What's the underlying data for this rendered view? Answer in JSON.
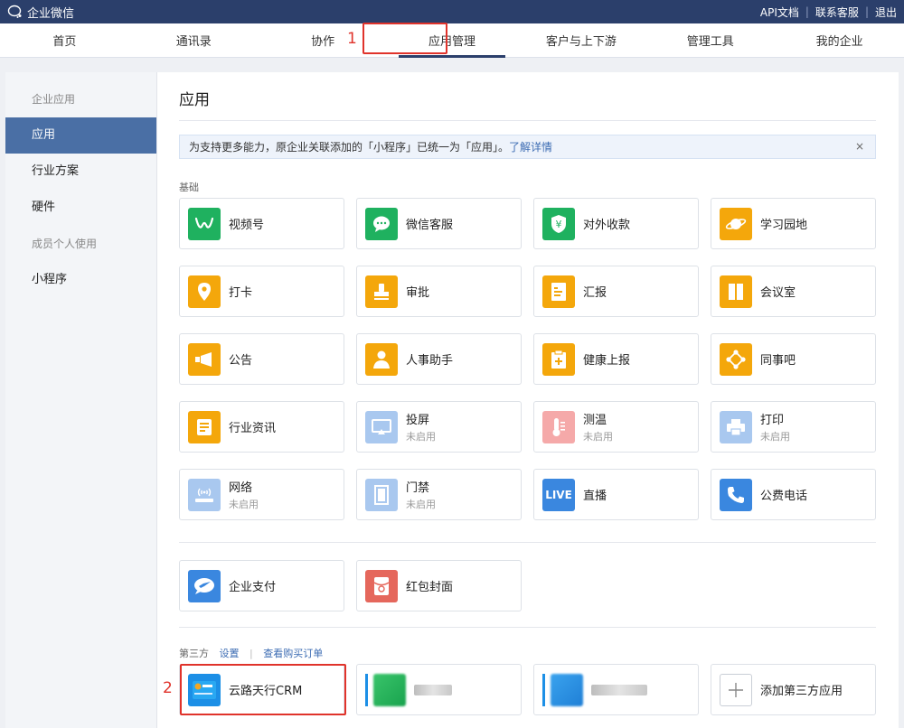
{
  "topbar": {
    "brand": "企业微信",
    "links": [
      "API文档",
      "联系客服",
      "退出"
    ]
  },
  "nav": {
    "tabs": [
      "首页",
      "通讯录",
      "协作",
      "应用管理",
      "客户与上下游",
      "管理工具",
      "我的企业"
    ],
    "active": "应用管理"
  },
  "annotations": {
    "a1": "1",
    "a2": "2"
  },
  "sidebar": {
    "group1": "企业应用",
    "items": [
      "应用",
      "行业方案",
      "硬件"
    ],
    "group2": "成员个人使用",
    "items2": [
      "小程序"
    ]
  },
  "main": {
    "title": "应用",
    "notice": {
      "text": "为支持更多能力，原企业关联添加的「小程序」已统一为「应用」。",
      "link": "了解详情",
      "close": "×"
    },
    "basic_label": "基础",
    "apps": [
      {
        "name": "视频号",
        "icon": "video-channel-icon",
        "color": "#1fb15f"
      },
      {
        "name": "微信客服",
        "icon": "wechat-service-icon",
        "color": "#1fb15f"
      },
      {
        "name": "对外收款",
        "icon": "yen-shield-icon",
        "color": "#1fb15f"
      },
      {
        "name": "学习园地",
        "icon": "planet-icon",
        "color": "#f4a70b"
      },
      {
        "name": "打卡",
        "icon": "location-pin-icon",
        "color": "#f4a70b"
      },
      {
        "name": "审批",
        "icon": "stamp-icon",
        "color": "#f4a70b"
      },
      {
        "name": "汇报",
        "icon": "report-icon",
        "color": "#f4a70b"
      },
      {
        "name": "会议室",
        "icon": "door-icon",
        "color": "#f4a70b"
      },
      {
        "name": "公告",
        "icon": "megaphone-icon",
        "color": "#f4a70b"
      },
      {
        "name": "人事助手",
        "icon": "person-icon",
        "color": "#f4a70b"
      },
      {
        "name": "健康上报",
        "icon": "health-clipboard-icon",
        "color": "#f4a70b"
      },
      {
        "name": "同事吧",
        "icon": "network-icon",
        "color": "#f4a70b"
      },
      {
        "name": "行业资讯",
        "icon": "news-icon",
        "color": "#f4a70b"
      },
      {
        "name": "投屏",
        "sub": "未启用",
        "icon": "screencast-icon",
        "color": "#a9c8ef"
      },
      {
        "name": "测温",
        "sub": "未启用",
        "icon": "thermometer-icon",
        "color": "#f5a9a9"
      },
      {
        "name": "打印",
        "sub": "未启用",
        "icon": "printer-icon",
        "color": "#a9c8ef"
      },
      {
        "name": "网络",
        "sub": "未启用",
        "icon": "router-icon",
        "color": "#a9c8ef"
      },
      {
        "name": "门禁",
        "sub": "未启用",
        "icon": "access-door-icon",
        "color": "#a9c8ef"
      },
      {
        "name": "直播",
        "icon": "live-icon",
        "badge": "LIVE",
        "color": "#3a87df"
      },
      {
        "name": "公费电话",
        "icon": "phone-icon",
        "color": "#3a87df"
      }
    ],
    "extra_apps": [
      {
        "name": "企业支付",
        "icon": "payment-icon",
        "color": "#3a87df"
      },
      {
        "name": "红包封面",
        "icon": "red-packet-icon",
        "color": "#e5675c"
      }
    ],
    "third_party": {
      "label": "第三方",
      "settings": "设置",
      "orders": "查看购买订单",
      "apps": [
        {
          "name": "云路天行CRM",
          "icon": "crm-card-icon"
        }
      ],
      "add_label": "添加第三方应用"
    }
  }
}
